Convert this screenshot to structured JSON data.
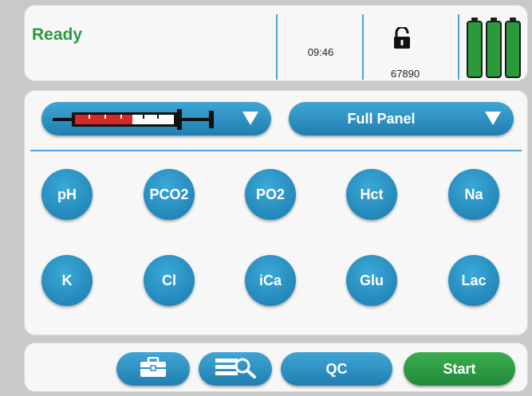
{
  "status": {
    "state": "Ready",
    "time": "09:46",
    "lock_code": "67890",
    "battery_levels": [
      1.0,
      1.0,
      1.0
    ]
  },
  "sample": {
    "syringe_icon": "syringe-icon",
    "panel_selector": "Full Panel"
  },
  "analytes": [
    "pH",
    "PCO2",
    "PO2",
    "Hct",
    "Na",
    "K",
    "Cl",
    "iCa",
    "Glu",
    "Lac"
  ],
  "toolbar": {
    "tools_icon": "toolbox-icon",
    "search_icon": "list-search-icon",
    "qc_label": "QC",
    "start_label": "Start"
  },
  "colors": {
    "accent_blue": "#2a8fc2",
    "ready_green": "#2b9a3e",
    "start_green": "#2a9a3f"
  }
}
